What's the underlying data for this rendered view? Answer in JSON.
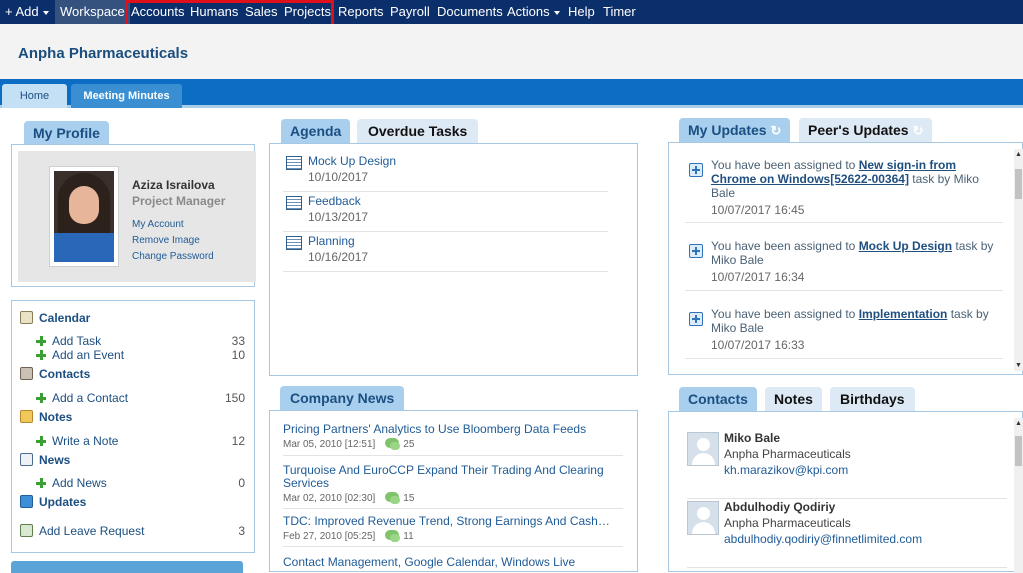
{
  "nav": {
    "add_label": "+ Add",
    "items": [
      "Workspace",
      "Accounts",
      "Humans",
      "Sales",
      "Projects",
      "Reports",
      "Payroll",
      "Documents",
      "Actions",
      "Help",
      "Timer"
    ]
  },
  "company": {
    "name": "Anpha Pharmaceuticals"
  },
  "tabs": [
    "Home",
    "Meeting Minutes"
  ],
  "profile": {
    "title": "My Profile",
    "name": "Aziza Israilova",
    "role": "Project Manager",
    "links": [
      "My Account",
      "Remove Image",
      "Change Password"
    ]
  },
  "quicklinks": {
    "calendar": {
      "label": "Calendar",
      "add_task": "Add Task",
      "add_task_count": "33",
      "add_event": "Add an Event",
      "add_event_count": "10"
    },
    "contacts": {
      "label": "Contacts",
      "add_contact": "Add a Contact",
      "add_contact_count": "150"
    },
    "notes": {
      "label": "Notes",
      "write_note": "Write a Note",
      "write_note_count": "12"
    },
    "news": {
      "label": "News",
      "add_news": "Add News",
      "add_news_count": "0"
    },
    "updates": {
      "label": "Updates"
    },
    "leave": {
      "label": "Add Leave Request",
      "count": "3"
    }
  },
  "agenda": {
    "tabs": [
      "Agenda",
      "Overdue Tasks"
    ],
    "items": [
      {
        "title": "Mock Up Design",
        "date": "10/10/2017"
      },
      {
        "title": "Feedback",
        "date": "10/13/2017"
      },
      {
        "title": "Planning",
        "date": "10/16/2017"
      }
    ]
  },
  "updates": {
    "tabs": [
      "My Updates",
      "Peer's Updates"
    ],
    "items": [
      {
        "prefix": "You have been assigned to ",
        "link": "New sign-in from Chrome on Windows[52622-00364]",
        "suffix": " task by Miko Bale",
        "date": "10/07/2017 16:45"
      },
      {
        "prefix": "You have been assigned to ",
        "link": "Mock Up Design",
        "suffix": " task by Miko Bale",
        "date": "10/07/2017 16:34"
      },
      {
        "prefix": "You have been assigned to ",
        "link": "Implementation",
        "suffix": " task by Miko Bale",
        "date": "10/07/2017 16:33"
      }
    ]
  },
  "news": {
    "title": "Company News",
    "items": [
      {
        "title": "Pricing Partners' Analytics to Use Bloomberg Data Feeds",
        "date": "Mar 05, 2010 [12:51]",
        "comments": "25"
      },
      {
        "title": "Turquoise And EuroCCP Expand Their Trading And Clearing Services",
        "date": "Mar 02, 2010 [02:30]",
        "comments": "15"
      },
      {
        "title": "TDC: Improved Revenue Trend, Strong Earnings And Cash…",
        "date": "Feb 27, 2010 [05:25]",
        "comments": "11"
      },
      {
        "title": "Contact Management, Google Calendar, Windows Live",
        "date": "",
        "comments": ""
      }
    ]
  },
  "contacts_panel": {
    "tabs": [
      "Contacts",
      "Notes",
      "Birthdays"
    ],
    "items": [
      {
        "name": "Miko Bale",
        "company": "Anpha Pharmaceuticals",
        "email": "kh.marazikov@kpi.com"
      },
      {
        "name": "Abdulhodiy Qodiriy",
        "company": "Anpha Pharmaceuticals",
        "email": "abdulhodiy.qodiriy@finnetlimited.com"
      }
    ]
  },
  "colors": {
    "nav_bg": "#0b2f6b",
    "tabstrip_bg": "#0d6cc3",
    "highlight": "#e0101a",
    "link": "#1f5b97"
  }
}
